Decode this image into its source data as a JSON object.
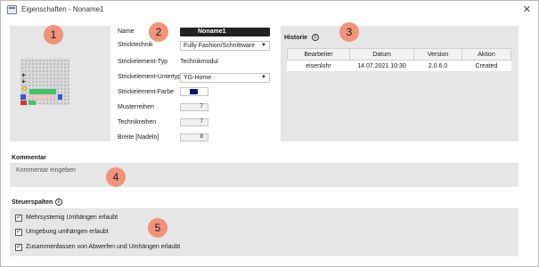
{
  "window": {
    "title": "Eigenschaften - Noname1",
    "close_label": "✕"
  },
  "markers": [
    "1",
    "2",
    "3",
    "4",
    "5"
  ],
  "form": {
    "name_label": "Name",
    "name_value": "Noname1",
    "stricktechnik_label": "Stricktechnik",
    "stricktechnik_value": "Fully Fashion/Schnittware",
    "strickelement_typ_label": "Strickelement-Typ",
    "strickelement_typ_value": "Technikmodul",
    "strickelement_untertyp_label": "Strickelement-Untertyp",
    "strickelement_untertyp_value": "YG-Home",
    "strickelement_farbe_label": "Strickelement-Farbe",
    "strickelement_farbe_color": "#12126e",
    "musterreihen_label": "Musterreihen",
    "musterreihen_value": "7",
    "technikreihen_label": "Technikreihen",
    "technikreihen_value": "7",
    "breite_label": "Breite [Nadeln]",
    "breite_value": "8"
  },
  "historie": {
    "title": "Historie",
    "columns": [
      "Bearbeiter",
      "Datum",
      "Version",
      "Aktion"
    ],
    "rows": [
      [
        "eisenlohr",
        "14.07.2021 10:30",
        "2.0.6.0",
        "Created"
      ]
    ]
  },
  "kommentar": {
    "title": "Kommentar",
    "placeholder": "Kommentar eingeben"
  },
  "steuerspalten": {
    "title": "Steuerspalten",
    "items": [
      {
        "label": "Mehrsystemig Umhängen erlaubt",
        "checked": "✓"
      },
      {
        "label": "Umgebung umhängen erlaubt",
        "checked": "✓"
      },
      {
        "label": "Zusammenfassen von Abwerfen und Umhängen erlaubt",
        "checked": "✓"
      }
    ]
  },
  "colors": {
    "marker": "#f0937a",
    "panel": "#e6e6e6",
    "accent_green": "#3ec46d"
  },
  "icons": {
    "info": "info-icon",
    "close": "close-icon",
    "dropdown": "chevron-down-icon"
  }
}
